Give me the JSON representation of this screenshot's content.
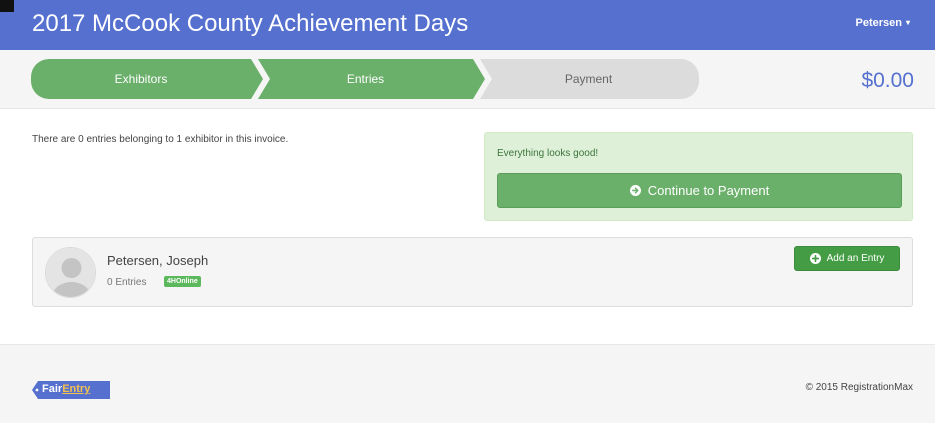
{
  "app": {
    "title": "2017 McCook County Achievement Days"
  },
  "user_menu": {
    "label": "Petersen",
    "caret": "▾"
  },
  "steps": [
    {
      "label": "Exhibitors",
      "state": "complete"
    },
    {
      "label": "Entries",
      "state": "complete"
    },
    {
      "label": "Payment",
      "state": "pending"
    }
  ],
  "invoice": {
    "total": "$0.00"
  },
  "summary": {
    "text": "There are 0 entries belonging to 1 exhibitor in this invoice."
  },
  "alert": {
    "message": "Everything looks good!",
    "button_label": "Continue to Payment",
    "button_icon": "circle-arrow-right-icon"
  },
  "exhibitor": {
    "name": "Petersen, Joseph",
    "entries": "0 Entries",
    "badge": "4HOnline",
    "add_button_label": "Add an Entry",
    "add_button_icon": "plus-circle-icon"
  },
  "footer": {
    "logo_part1": "Fair",
    "logo_part2": "Entry",
    "copyright": "© 2015 RegistrationMax"
  },
  "colors": {
    "header": "#5570cf",
    "step_complete": "#6aaf6a",
    "step_pending": "#dcdcdc",
    "success_bg": "#dff0d8",
    "add_button": "#449d44"
  }
}
